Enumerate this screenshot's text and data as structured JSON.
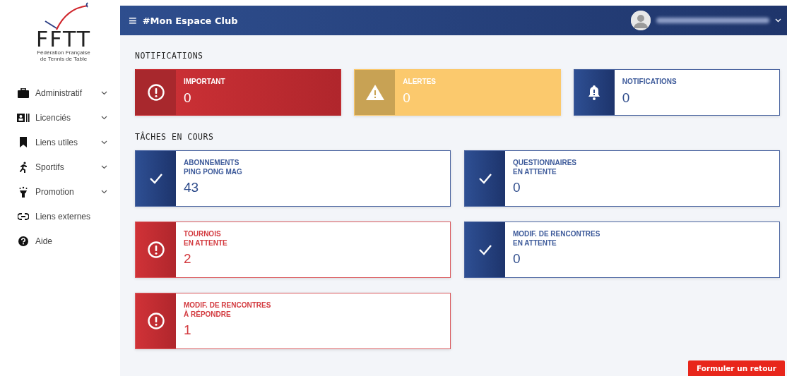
{
  "logo": {
    "wordmark": "FFTT",
    "subtitle_lines": [
      "Fédération Française",
      "de Tennis de Table"
    ]
  },
  "sidebar": {
    "items": [
      {
        "label": "Administratif",
        "expandable": true
      },
      {
        "label": "Licenciés",
        "expandable": true
      },
      {
        "label": "Liens utiles",
        "expandable": true
      },
      {
        "label": "Sportifs",
        "expandable": true
      },
      {
        "label": "Promotion",
        "expandable": true
      },
      {
        "label": "Liens externes",
        "expandable": false
      },
      {
        "label": "Aide",
        "expandable": false
      }
    ]
  },
  "topbar": {
    "menu_glyph": "≡",
    "title": "#Mon Espace Club"
  },
  "sections": [
    {
      "heading": "NOTIFICATIONS",
      "cards": [
        {
          "kind": "important",
          "label_lines": [
            "IMPORTANT"
          ],
          "count": "0"
        },
        {
          "kind": "alert",
          "label_lines": [
            "ALERTES"
          ],
          "count": "0"
        },
        {
          "kind": "notification",
          "label_lines": [
            "NOTIFICATIONS"
          ],
          "count": "0"
        }
      ]
    },
    {
      "heading": "TÂCHES EN COURS",
      "cards": [
        {
          "kind": "done",
          "label_lines": [
            "ABONNEMENTS",
            "PING PONG MAG"
          ],
          "count": "43"
        },
        {
          "kind": "done",
          "label_lines": [
            "QUESTIONNAIRES",
            "EN ATTENTE"
          ],
          "count": "0"
        },
        {
          "kind": "pending",
          "label_lines": [
            "TOURNOIS",
            "EN ATTENTE"
          ],
          "count": "2"
        },
        {
          "kind": "done",
          "label_lines": [
            "MODIF. DE RENCONTRES",
            "EN ATTENTE"
          ],
          "count": "0"
        },
        {
          "kind": "pending",
          "label_lines": [
            "MODIF. DE RENCONTRES",
            "À RÉPONDRE"
          ],
          "count": "1"
        }
      ]
    }
  ],
  "feedback_button": "Formuler un retour"
}
